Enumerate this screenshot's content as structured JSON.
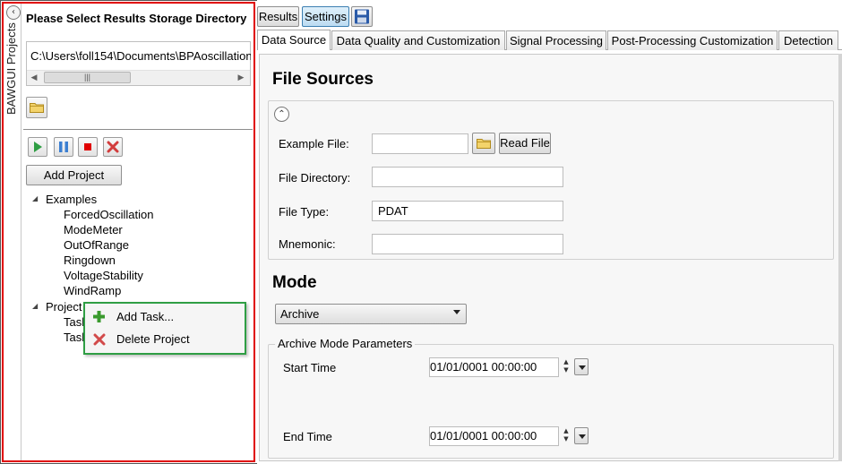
{
  "left_panel": {
    "vertical_title": "BAWGUI Projects",
    "storage_title": "Please Select Results Storage Directory",
    "storage_path": "C:\\Users\\foll154\\Documents\\BPAoscillation",
    "scroll_thumb_grip": "|||",
    "add_project_label": "Add Project",
    "controls": [
      "play-icon",
      "pause-icon",
      "stop-icon",
      "delete-x-icon"
    ],
    "tree": {
      "examples_label": "Examples",
      "examples": [
        "ForcedOscillation",
        "ModeMeter",
        "OutOfRange",
        "Ringdown",
        "VoltageStability",
        "WindRamp"
      ],
      "project_label": "Project",
      "project_children": [
        "Task",
        "Task"
      ]
    },
    "context_menu": {
      "add_task": "Add Task...",
      "delete_project": "Delete Project"
    }
  },
  "toolbar": {
    "results_label": "Results",
    "settings_label": "Settings",
    "save_icon": "save-floppy-icon"
  },
  "tabs": [
    {
      "label": "Data Source",
      "active": true
    },
    {
      "label": "Data Quality and Customization",
      "active": false
    },
    {
      "label": "Signal Processing",
      "active": false
    },
    {
      "label": "Post-Processing Customization",
      "active": false
    },
    {
      "label": "Detection",
      "active": false
    }
  ],
  "file_sources": {
    "title": "File Sources",
    "example_file_label": "Example File:",
    "example_file_value": "",
    "read_file_label": "Read File",
    "file_directory_label": "File Directory:",
    "file_directory_value": "",
    "file_type_label": "File Type:",
    "file_type_value": "PDAT",
    "mnemonic_label": "Mnemonic:",
    "mnemonic_value": ""
  },
  "mode": {
    "title": "Mode",
    "selected": "Archive",
    "archive_params_label": "Archive Mode Parameters",
    "start_time_label": "Start Time",
    "start_time_value": "01/01/0001 00:00:00",
    "end_time_label": "End Time",
    "end_time_value": "01/01/0001 00:00:00"
  },
  "colors": {
    "left_panel_border": "#e00000",
    "context_menu_border": "#2f9e44",
    "active_button": "#bcdcf2"
  }
}
